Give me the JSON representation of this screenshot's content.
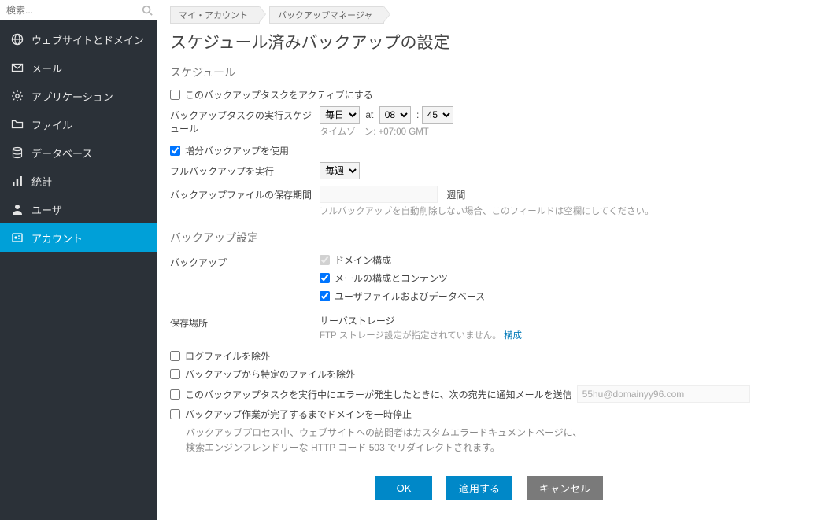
{
  "sidebar": {
    "search_placeholder": "検索...",
    "items": [
      {
        "label": "ウェブサイトとドメイン",
        "icon": "globe-icon"
      },
      {
        "label": "メール",
        "icon": "mail-icon"
      },
      {
        "label": "アプリケーション",
        "icon": "gear-icon"
      },
      {
        "label": "ファイル",
        "icon": "folder-icon"
      },
      {
        "label": "データベース",
        "icon": "database-icon"
      },
      {
        "label": "統計",
        "icon": "stats-icon"
      },
      {
        "label": "ユーザ",
        "icon": "user-icon"
      },
      {
        "label": "アカウント",
        "icon": "account-icon",
        "active": true
      }
    ]
  },
  "breadcrumb": {
    "items": [
      "マイ・アカウント",
      "バックアップマネージャ"
    ]
  },
  "page_title": "スケジュール済みバックアップの設定",
  "section_schedule": "スケジュール",
  "activate_label": "このバックアップタスクをアクティブにする",
  "run_schedule_label": "バックアップタスクの実行スケジュール",
  "freq_options": [
    "毎日"
  ],
  "freq_value": "毎日",
  "at_label": "at",
  "hour_value": "08",
  "minute_value": "45",
  "colon": ":",
  "timezone_label": "タイムゾーン: +07:00 GMT",
  "incremental_label": "増分バックアップを使用",
  "full_backup_label": "フルバックアップを実行",
  "full_freq_value": "毎週",
  "retention_label": "バックアップファイルの保存期間",
  "retention_unit": "週間",
  "retention_hint": "フルバックアップを自動削除しない場合、このフィールドは空欄にしてください。",
  "section_settings": "バックアップ設定",
  "backup_label": "バックアップ",
  "chk_domain": "ドメイン構成",
  "chk_mail": "メールの構成とコンテンツ",
  "chk_userfiles": "ユーザファイルおよびデータベース",
  "storage_label": "保存場所",
  "storage_value": "サーバストレージ",
  "storage_hint_prefix": "FTP ストレージ設定が指定されていません。",
  "storage_configure": "構成",
  "exclude_logs_label": "ログファイルを除外",
  "exclude_files_label": "バックアップから特定のファイルを除外",
  "notify_label": "このバックアップタスクを実行中にエラーが発生したときに、次の宛先に通知メールを送信",
  "notify_email": "55hu@domainyy96.com",
  "suspend_label": "バックアップ作業が完了するまでドメインを一時停止",
  "suspend_desc1": "バックアッププロセス中、ウェブサイトへの訪問者はカスタムエラードキュメントページに、",
  "suspend_desc2": "検索エンジンフレンドリーな HTTP コード 503 でリダイレクトされます。",
  "buttons": {
    "ok": "OK",
    "apply": "適用する",
    "cancel": "キャンセル"
  }
}
